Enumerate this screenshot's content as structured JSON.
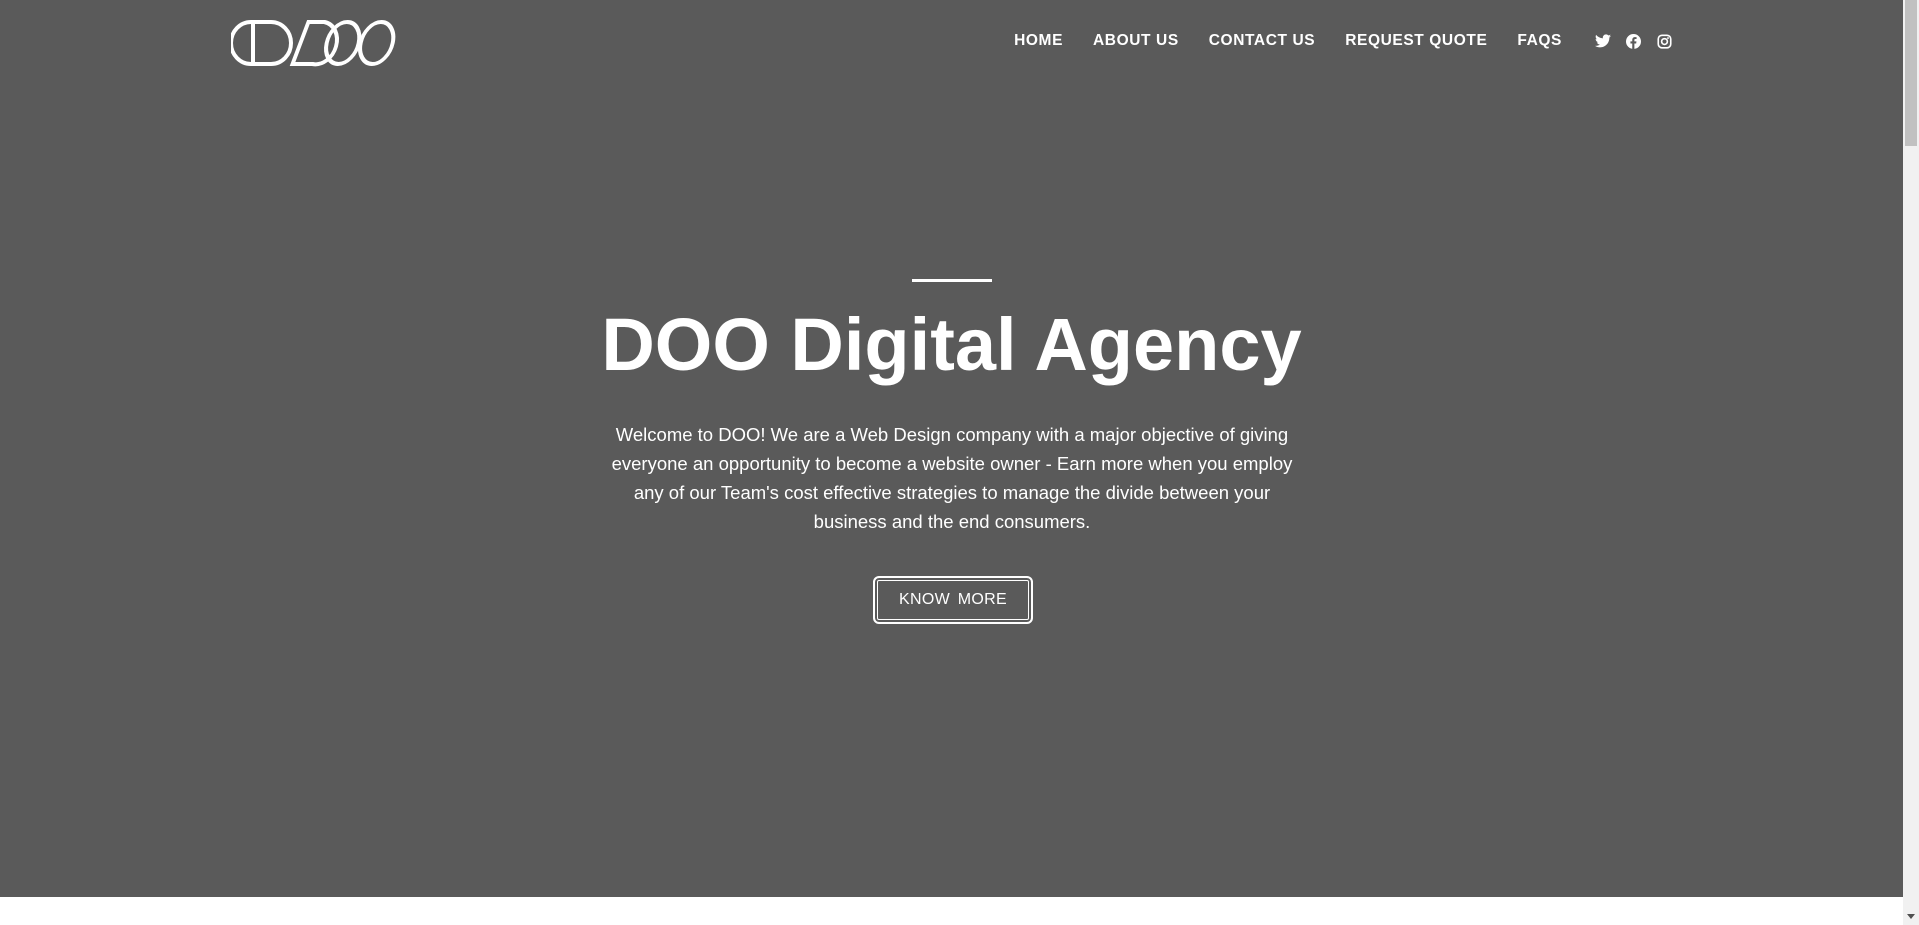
{
  "header": {
    "logo_text": "DOO",
    "nav": [
      {
        "label": "HOME"
      },
      {
        "label": "ABOUT US"
      },
      {
        "label": "CONTACT US"
      },
      {
        "label": "REQUEST QUOTE"
      },
      {
        "label": "FAQS"
      }
    ],
    "socials": [
      {
        "icon": "twitter-icon"
      },
      {
        "icon": "facebook-icon"
      },
      {
        "icon": "instagram-icon"
      }
    ]
  },
  "hero": {
    "title": "DOO Digital Agency",
    "text": "Welcome to DOO! We are a Web Design company with a major objective of giving everyone an opportunity to become a website owner - Earn more when you employ any of our Team's cost effective strategies to manage the divide between your business and the end consumers.",
    "button_label": "KNOW MORE"
  },
  "colors": {
    "hero_background": "#5a5a5a",
    "text": "#ffffff",
    "page_background": "#ffffff"
  }
}
